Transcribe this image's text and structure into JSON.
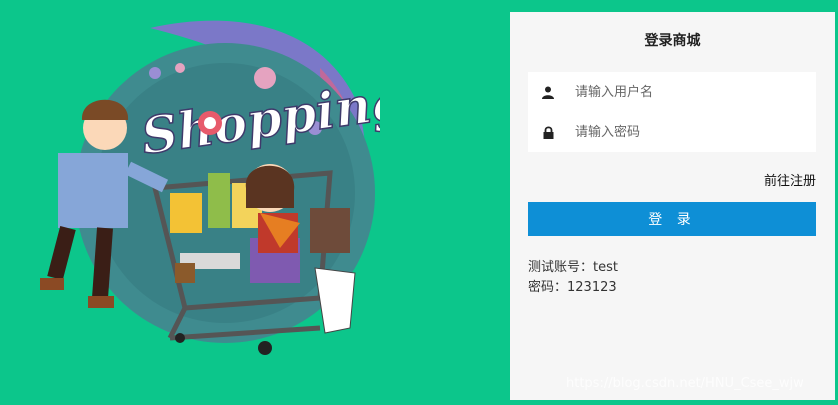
{
  "illustration": {
    "title_text": "Shopping"
  },
  "login": {
    "title": "登录商城",
    "username_placeholder": "请输入用户名",
    "password_placeholder": "请输入密码",
    "register_link": "前往注册",
    "login_button": "登 录",
    "hint_account": "测试账号：test",
    "hint_password": "密码：123123"
  },
  "watermark": "https://blog.csdn.net/HNU_Csee_wjw",
  "colors": {
    "background": "#0cc68b",
    "panel": "#f6f6f6",
    "button": "#0e8fd6"
  },
  "icons": {
    "username": "user-icon",
    "password": "lock-icon"
  }
}
